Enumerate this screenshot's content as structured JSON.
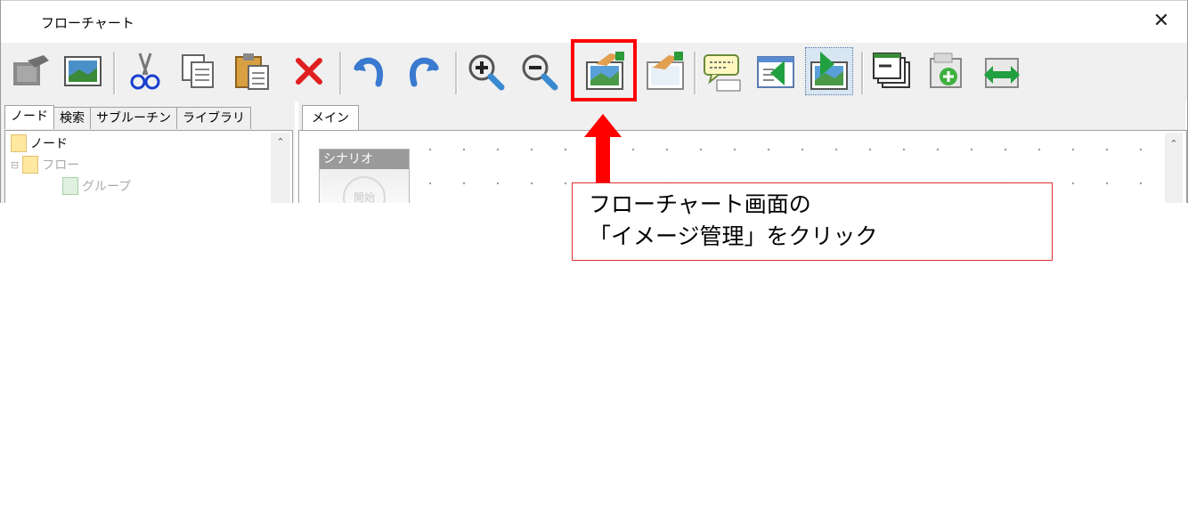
{
  "window": {
    "title": "フローチャート",
    "close_glyph": "✕"
  },
  "toolbar": {
    "buttons": [
      {
        "name": "scenario-image-icon"
      },
      {
        "name": "image-icon"
      },
      {
        "name": "cut-icon"
      },
      {
        "name": "copy-icon"
      },
      {
        "name": "paste-icon"
      },
      {
        "name": "delete-icon"
      },
      {
        "name": "undo-icon"
      },
      {
        "name": "redo-icon"
      },
      {
        "name": "zoom-in-icon"
      },
      {
        "name": "zoom-out-icon"
      },
      {
        "name": "image-manage-icon"
      },
      {
        "name": "image-edit-icon"
      },
      {
        "name": "comment-icon"
      },
      {
        "name": "move-left-icon"
      },
      {
        "name": "move-right-icon"
      },
      {
        "name": "window-stack-icon"
      },
      {
        "name": "add-node-icon"
      },
      {
        "name": "swap-icon"
      }
    ],
    "selected_button": "move-right-icon"
  },
  "left_panel": {
    "tabs": [
      "ノード",
      "検索",
      "サブルーチン",
      "ライブラリ"
    ],
    "active_tab": "ノード",
    "tree": {
      "root": "ノード",
      "child": "フロー",
      "grandchild": "グループ"
    }
  },
  "main_panel": {
    "tab": "メイン",
    "scenario_node": {
      "header": "シナリオ",
      "start_label": "開始"
    }
  },
  "annotation": {
    "line1": "フローチャート画面の",
    "line2": "「イメージ管理」をクリック",
    "highlight_color": "#ff0000",
    "callout_border": "#e03030"
  }
}
